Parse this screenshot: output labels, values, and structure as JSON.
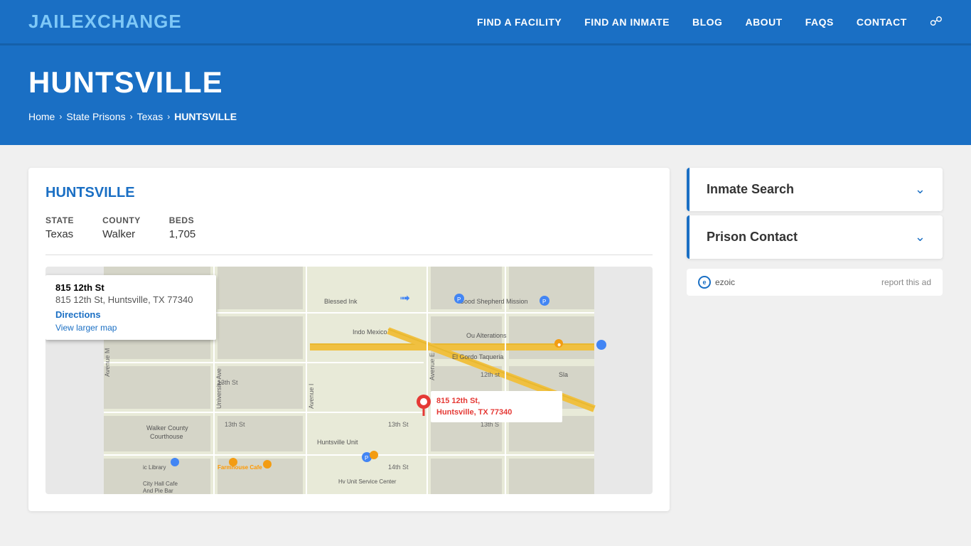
{
  "header": {
    "logo_jail": "JAIL",
    "logo_exchange": "EXCHANGE",
    "nav": [
      {
        "label": "FIND A FACILITY",
        "id": "find-facility"
      },
      {
        "label": "FIND AN INMATE",
        "id": "find-inmate"
      },
      {
        "label": "BLOG",
        "id": "blog"
      },
      {
        "label": "ABOUT",
        "id": "about"
      },
      {
        "label": "FAQs",
        "id": "faqs"
      },
      {
        "label": "CONTACT",
        "id": "contact"
      }
    ]
  },
  "hero": {
    "title": "HUNTSVILLE",
    "breadcrumb": [
      {
        "label": "Home",
        "id": "home"
      },
      {
        "label": "State Prisons",
        "id": "state-prisons"
      },
      {
        "label": "Texas",
        "id": "texas"
      },
      {
        "label": "HUNTSVILLE",
        "id": "huntsville",
        "current": true
      }
    ]
  },
  "facility": {
    "name": "HUNTSVILLE",
    "state_label": "STATE",
    "state_value": "Texas",
    "county_label": "COUNTY",
    "county_value": "Walker",
    "beds_label": "BEDS",
    "beds_value": "1,705"
  },
  "map": {
    "info_street": "815 12th St",
    "info_address": "815 12th St, Huntsville, TX 77340",
    "directions_label": "Directions",
    "view_larger_label": "View larger map",
    "pin_label": "815 12th St,\nHuntsville, TX 77340"
  },
  "sidebar": {
    "cards": [
      {
        "label": "Inmate Search",
        "id": "inmate-search"
      },
      {
        "label": "Prison Contact",
        "id": "prison-contact"
      }
    ],
    "ad": {
      "ezoic_label": "ezoic",
      "report_label": "report this ad"
    }
  }
}
